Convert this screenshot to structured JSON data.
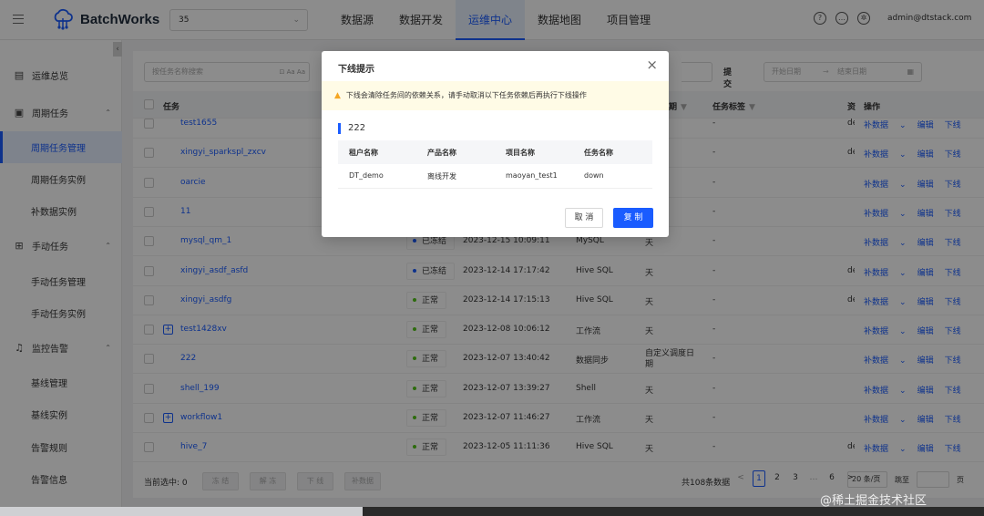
{
  "header": {
    "app_name": "BatchWorks",
    "project_value": "35",
    "nav": [
      "数据源",
      "数据开发",
      "运维中心",
      "数据地图",
      "项目管理"
    ],
    "active_nav": "运维中心",
    "icons": [
      "help-icon",
      "message-icon",
      "settings-icon"
    ],
    "user": "admin@dtstack.com",
    "accent": "#1a5cff"
  },
  "sidebar": {
    "items": [
      {
        "label": "运维总览",
        "type": "group",
        "icon": "overview-icon"
      },
      {
        "label": "周期任务",
        "type": "group",
        "icon": "calendar-icon",
        "expanded": true
      },
      {
        "label": "周期任务管理",
        "type": "sub",
        "active": true
      },
      {
        "label": "周期任务实例",
        "type": "sub"
      },
      {
        "label": "补数据实例",
        "type": "sub"
      },
      {
        "label": "手动任务",
        "type": "group",
        "icon": "manual-icon",
        "expanded": true
      },
      {
        "label": "手动任务管理",
        "type": "sub"
      },
      {
        "label": "手动任务实例",
        "type": "sub"
      },
      {
        "label": "监控告警",
        "type": "group",
        "icon": "bell-icon",
        "expanded": true
      },
      {
        "label": "基线管理",
        "type": "sub"
      },
      {
        "label": "基线实例",
        "type": "sub"
      },
      {
        "label": "告警规则",
        "type": "sub"
      },
      {
        "label": "告警信息",
        "type": "sub"
      }
    ]
  },
  "filters": {
    "search_placeholder": "按任务名称搜索",
    "search_aa": "Aa",
    "submit_time_label": "提交时间",
    "start_date_placeholder": "开始日期",
    "end_date_placeholder": "结束日期",
    "date_sep": "→"
  },
  "table": {
    "headers": {
      "name": "任务",
      "period": "期",
      "tag": "任务标签",
      "res": "资",
      "actions": "操作"
    },
    "action_labels": {
      "supplement": "补数据",
      "edit": "编辑",
      "offline": "下线"
    },
    "rows": [
      {
        "name": "test1655",
        "status": "",
        "time": "",
        "type": "",
        "period": "",
        "tag": "-",
        "res": "de",
        "expandable": false
      },
      {
        "name": "xingyi_sparkspl_zxcv",
        "status": "",
        "time": "",
        "type": "",
        "period": "",
        "tag": "-",
        "res": "de",
        "expandable": false
      },
      {
        "name": "oarcie",
        "status": "",
        "time": "",
        "type": "",
        "period": "",
        "tag": "-",
        "res": "",
        "expandable": false
      },
      {
        "name": "11",
        "status": "",
        "time": "",
        "type": "",
        "period": "",
        "tag": "-",
        "res": "",
        "expandable": false
      },
      {
        "name": "mysql_qm_1",
        "status": "已冻结",
        "time": "2023-12-15 10:09:11",
        "type": "MySQL",
        "period": "天",
        "tag": "-",
        "res": "",
        "expandable": false
      },
      {
        "name": "xingyi_asdf_asfd",
        "status": "已冻结",
        "time": "2023-12-14 17:17:42",
        "type": "Hive SQL",
        "period": "天",
        "tag": "-",
        "res": "de",
        "expandable": false
      },
      {
        "name": "xingyi_asdfg",
        "status": "正常",
        "time": "2023-12-14 17:15:13",
        "type": "Hive SQL",
        "period": "天",
        "tag": "-",
        "res": "de",
        "expandable": false
      },
      {
        "name": "test1428xv",
        "status": "正常",
        "time": "2023-12-08 10:06:12",
        "type": "工作流",
        "period": "天",
        "tag": "-",
        "res": "",
        "expandable": true
      },
      {
        "name": "222",
        "status": "正常",
        "time": "2023-12-07 13:40:42",
        "type": "数据同步",
        "period": "自定义调度日期",
        "tag": "-",
        "res": "",
        "expandable": false
      },
      {
        "name": "shell_199",
        "status": "正常",
        "time": "2023-12-07 13:39:27",
        "type": "Shell",
        "period": "天",
        "tag": "-",
        "res": "",
        "expandable": false
      },
      {
        "name": "workflow1",
        "status": "正常",
        "time": "2023-12-07 11:46:27",
        "type": "工作流",
        "period": "天",
        "tag": "-",
        "res": "",
        "expandable": true
      },
      {
        "name": "hive_7",
        "status": "正常",
        "time": "2023-12-05 11:11:36",
        "type": "Hive SQL",
        "period": "天",
        "tag": "-",
        "res": "de",
        "expandable": false
      }
    ],
    "status_colors": {
      "正常": "#52c41a",
      "已冻结": "#1a5cff"
    }
  },
  "footer": {
    "selected_label": "当前选中: 0",
    "buttons": [
      "冻 结",
      "解 冻",
      "下 线",
      "补数据"
    ],
    "total": "共108条数据",
    "pages": [
      "1",
      "2",
      "3",
      "6"
    ],
    "ellipsis": "…",
    "prev": "<",
    "next": ">",
    "page_size": "20 条/页",
    "jump_label": "跳至",
    "page_suffix": "页"
  },
  "modal": {
    "title": "下线提示",
    "warning": "下线会清除任务间的依赖关系，请手动取消以下任务依赖后再执行下线操作",
    "section": "222",
    "columns": [
      "租户名称",
      "产品名称",
      "项目名称",
      "任务名称"
    ],
    "rows": [
      [
        "DT_demo",
        "离线开发",
        "maoyan_test1",
        "down"
      ]
    ],
    "cancel": "取 消",
    "copy": "复 制"
  },
  "watermark": "@稀土掘金技术社区"
}
